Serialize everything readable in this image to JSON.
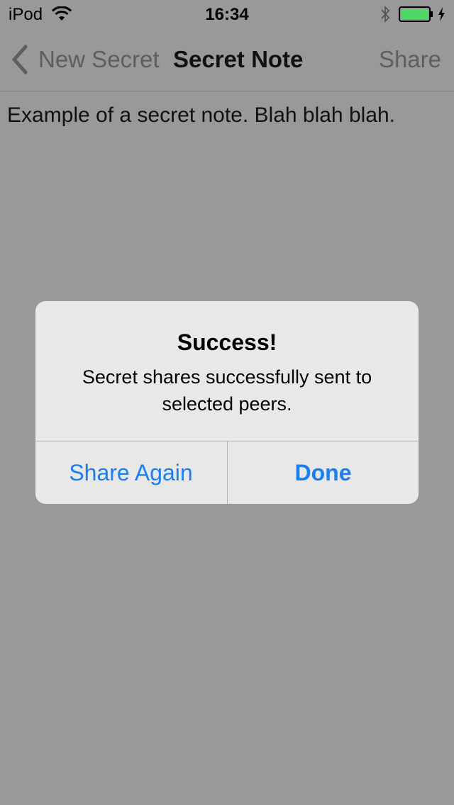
{
  "status_bar": {
    "carrier": "iPod",
    "time": "16:34",
    "wifi_icon": "wifi-icon",
    "bluetooth_icon": "bluetooth-icon",
    "battery_icon": "battery-icon",
    "battery_level": 1.0,
    "battery_color": "#4cd964",
    "charging_icon": "charging-bolt-icon"
  },
  "nav_bar": {
    "back_label": "New Secret",
    "title": "Secret Note",
    "share_label": "Share"
  },
  "note": {
    "text": "Example of a secret note. Blah blah blah."
  },
  "alert": {
    "title": "Success!",
    "message": "Secret shares successfully sent to selected peers.",
    "buttons": [
      {
        "label": "Share Again"
      },
      {
        "label": "Done"
      }
    ],
    "button_color": "#1a7ff0"
  }
}
